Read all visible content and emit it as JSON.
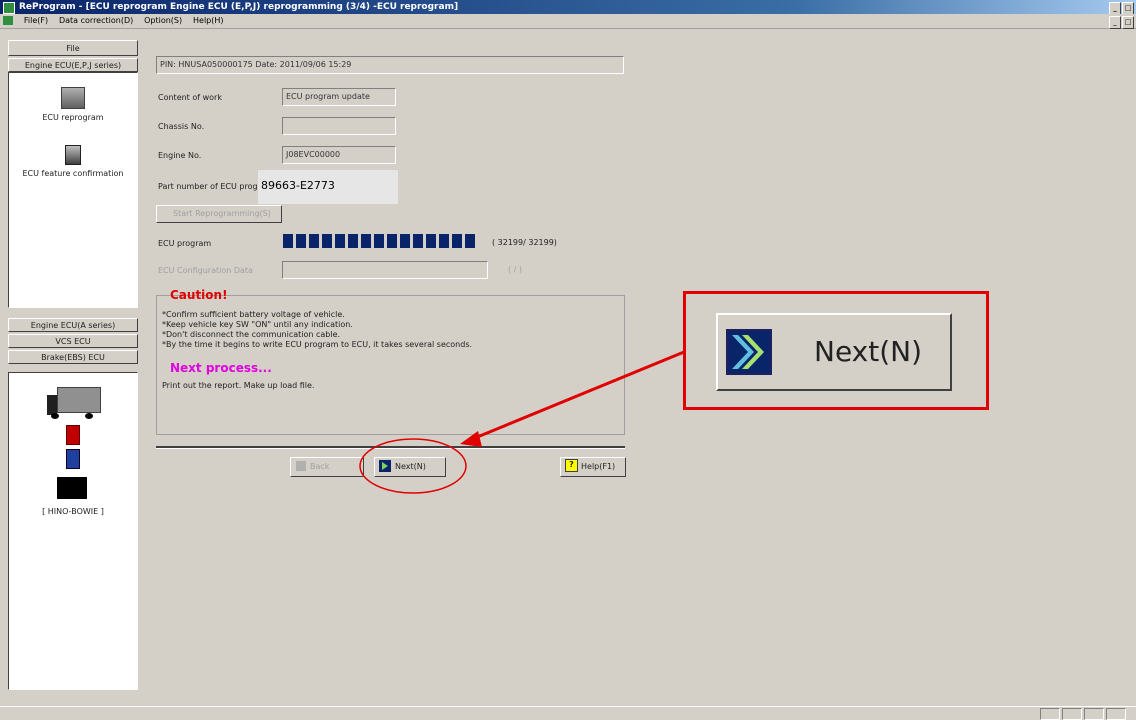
{
  "window": {
    "title": "ReProgram - [ECU reprogram Engine ECU (E,P,J) reprogramming (3/4) -ECU reprogram]"
  },
  "menu": [
    "File(F)",
    "Data correction(D)",
    "Option(S)",
    "Help(H)"
  ],
  "sidebar": {
    "file_tab": "File",
    "engine_tab": "Engine ECU(E,P,J series)",
    "items": [
      {
        "label": "ECU reprogram",
        "icon": "laptop-icon"
      },
      {
        "label": "ECU feature confirmation",
        "icon": "scanner-icon"
      }
    ],
    "buttons": [
      "Engine ECU(A series)",
      "VCS ECU",
      "Brake(EBS) ECU"
    ],
    "vehicle_caption": "[ HINO-BOWIE ]"
  },
  "main": {
    "pin_line": "PIN: HNUSA050000175  Date: 2011/09/06 15:29",
    "content_label": "Content of work",
    "content_value": "ECU program update",
    "chassis_label": "Chassis No.",
    "chassis_value": "",
    "engine_label": "Engine No.",
    "engine_value": "J08EVC00000",
    "part_label": "Part number of ECU program",
    "part_value": "89663-E2773",
    "start_button": "Start Reprogramming(S)",
    "ecu_program_label": "ECU program",
    "ecu_program_count": "(   32199/   32199)",
    "ecu_program_progress": 1.0,
    "config_label": "ECU Configuration Data",
    "config_count": "(        /        )",
    "caution_title": "Caution!",
    "caution_lines": [
      "*Confirm sufficient battery voltage of vehicle.",
      "*Keep vehicle key SW \"ON\" until any indication.",
      "*Don't disconnect the communication cable.",
      "*By the time it begins to write ECU program to ECU, it takes several seconds."
    ],
    "next_title": "Next process...",
    "next_text": "Print out the report. Make up load file.",
    "back_button": "Back",
    "next_button": "Next(N)",
    "help_button": "Help(F1)"
  },
  "callout": {
    "next_label": "Next(N)"
  },
  "colors": {
    "progress": "#0a246a",
    "caution": "#e00000",
    "next_process": "#e000e0",
    "annotation": "#e00000"
  }
}
